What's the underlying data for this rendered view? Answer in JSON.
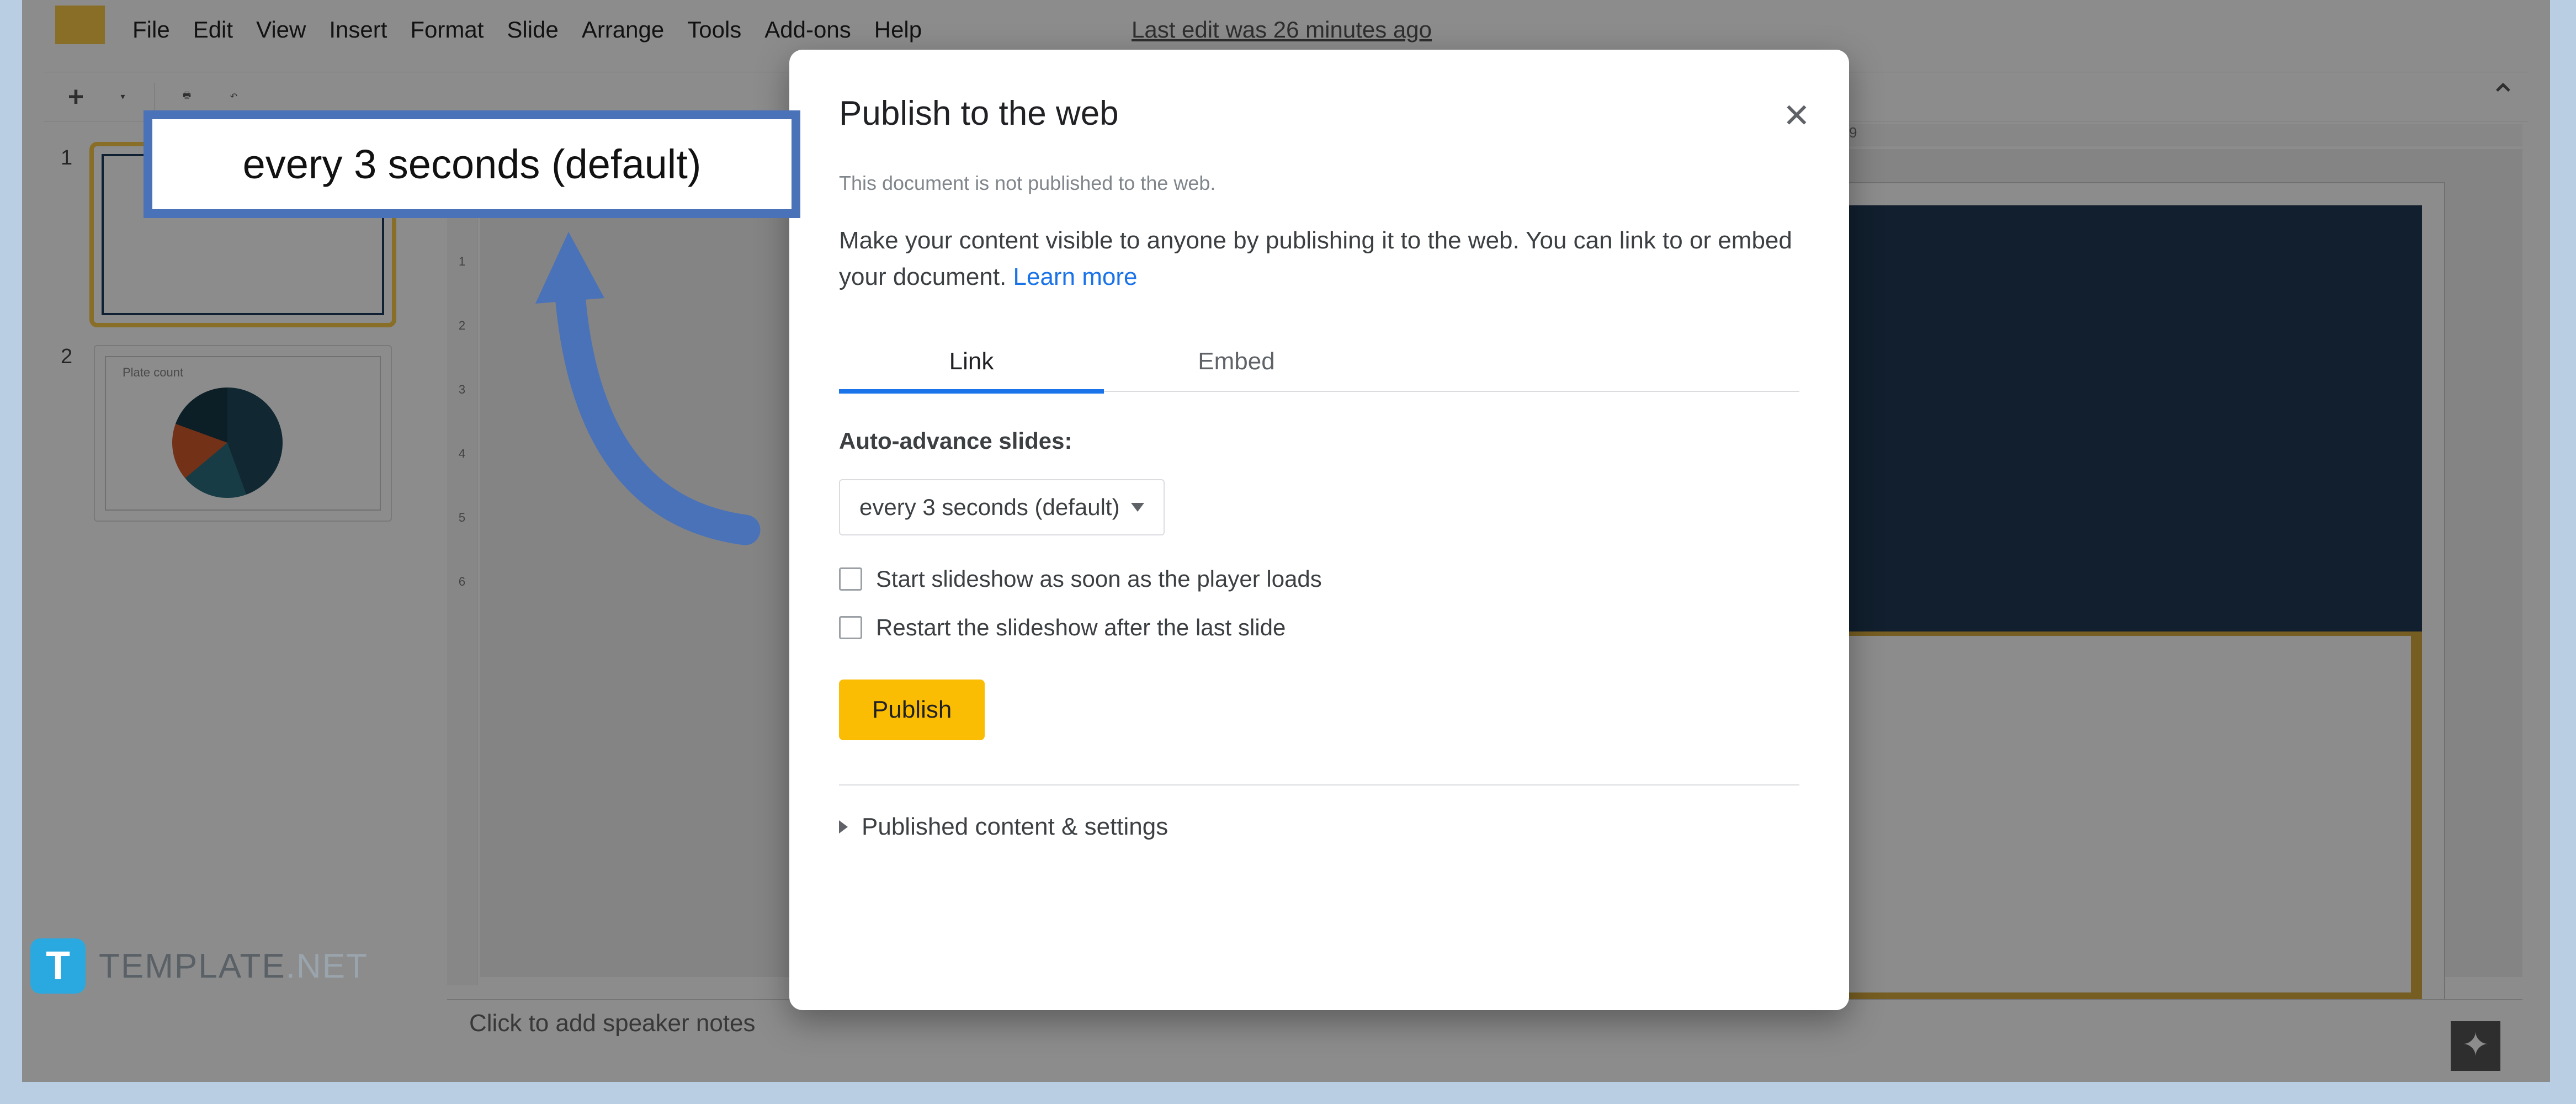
{
  "menubar": {
    "items": [
      "File",
      "Edit",
      "View",
      "Insert",
      "Format",
      "Slide",
      "Arrange",
      "Tools",
      "Add-ons",
      "Help"
    ],
    "last_edit": "Last edit was 26 minutes ago"
  },
  "slides": {
    "numbers": [
      "1",
      "2"
    ],
    "thumb2_title": "Plate count"
  },
  "ruler": {
    "v": [
      "1",
      "",
      "1",
      "2",
      "3",
      "4",
      "5",
      "6"
    ],
    "h_mark": "9"
  },
  "notes": {
    "placeholder": "Click to add speaker notes"
  },
  "dialog": {
    "title": "Publish to the web",
    "not_published": "This document is not published to the web.",
    "desc_pre": "Make your content visible to anyone by publishing it to the web. You can link to or embed your document. ",
    "learn_more": "Learn more",
    "tabs": {
      "link": "Link",
      "embed": "Embed"
    },
    "auto_advance_label": "Auto-advance slides:",
    "auto_advance_value": "every 3 seconds (default)",
    "check_start": "Start slideshow as soon as the player loads",
    "check_restart": "Restart the slideshow after the last slide",
    "publish": "Publish",
    "expand": "Published content & settings"
  },
  "callout": {
    "text": "every 3 seconds (default)"
  },
  "watermark": {
    "icon": "T",
    "brand": "TEMPLATE",
    "suffix": ".NET"
  }
}
